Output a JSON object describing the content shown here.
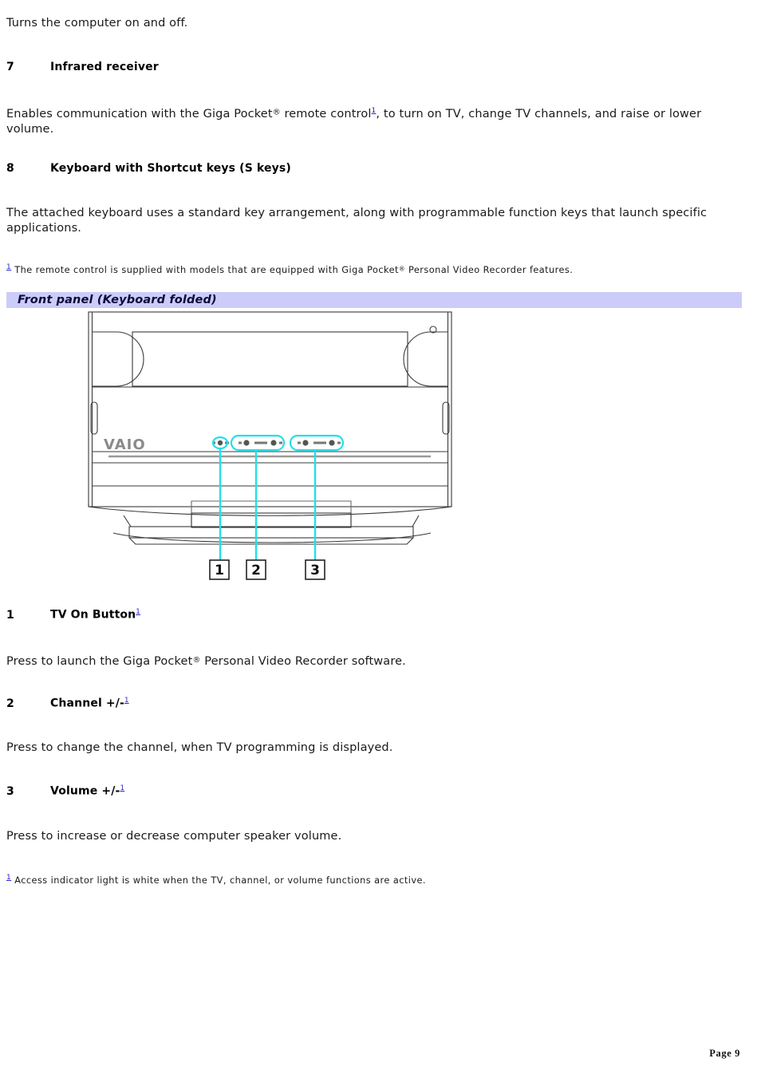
{
  "document": {
    "page_label": "Page 9"
  },
  "intro": {
    "text": "Turns the computer on and off."
  },
  "sections": [
    {
      "number": "7",
      "title": "Infrared receiver",
      "body_before": "Enables communication with the Giga Pocket",
      "body_reg": "®",
      "body_mid": " remote control",
      "footnote_marker": "1",
      "body_after": ", to turn on TV, change TV channels, and raise or lower volume."
    },
    {
      "number": "8",
      "title": "Keyboard with Shortcut keys (S keys)",
      "body": "The attached keyboard uses a standard key arrangement, along with programmable function keys that launch specific applications."
    }
  ],
  "footnote_top": {
    "marker": "1",
    "before": " The remote control is supplied with models that are equipped with Giga Pocket",
    "reg": "®",
    "after": " Personal Video Recorder features."
  },
  "banner": {
    "label": "Front panel (Keyboard folded)",
    "background_color": "#ccccfa",
    "text_color": "#0a0a3c"
  },
  "figure": {
    "name": "vaio-front-panel-keyboard-folded",
    "brand_logo": "VAIO",
    "callout_color": "#22e0e8",
    "line_color": "#333333",
    "callouts": [
      {
        "number": "1",
        "target": "tv-on-button"
      },
      {
        "number": "2",
        "target": "channel-plus-minus-buttons"
      },
      {
        "number": "3",
        "target": "volume-plus-minus-buttons"
      }
    ]
  },
  "items": [
    {
      "number": "1",
      "title": "TV On Button",
      "footnote_marker": "1",
      "body_before": "Press to launch the Giga Pocket",
      "body_reg": "®",
      "body_after": " Personal Video Recorder software."
    },
    {
      "number": "2",
      "title": "Channel +/-",
      "footnote_marker": "1",
      "body": "Press to change the channel, when TV programming is displayed."
    },
    {
      "number": "3",
      "title": "Volume +/-",
      "footnote_marker": "1",
      "body": "Press to increase or decrease computer speaker volume."
    }
  ],
  "footnote_bottom": {
    "marker": "1",
    "text": " Access indicator light is white when the TV, channel, or volume functions are active."
  }
}
